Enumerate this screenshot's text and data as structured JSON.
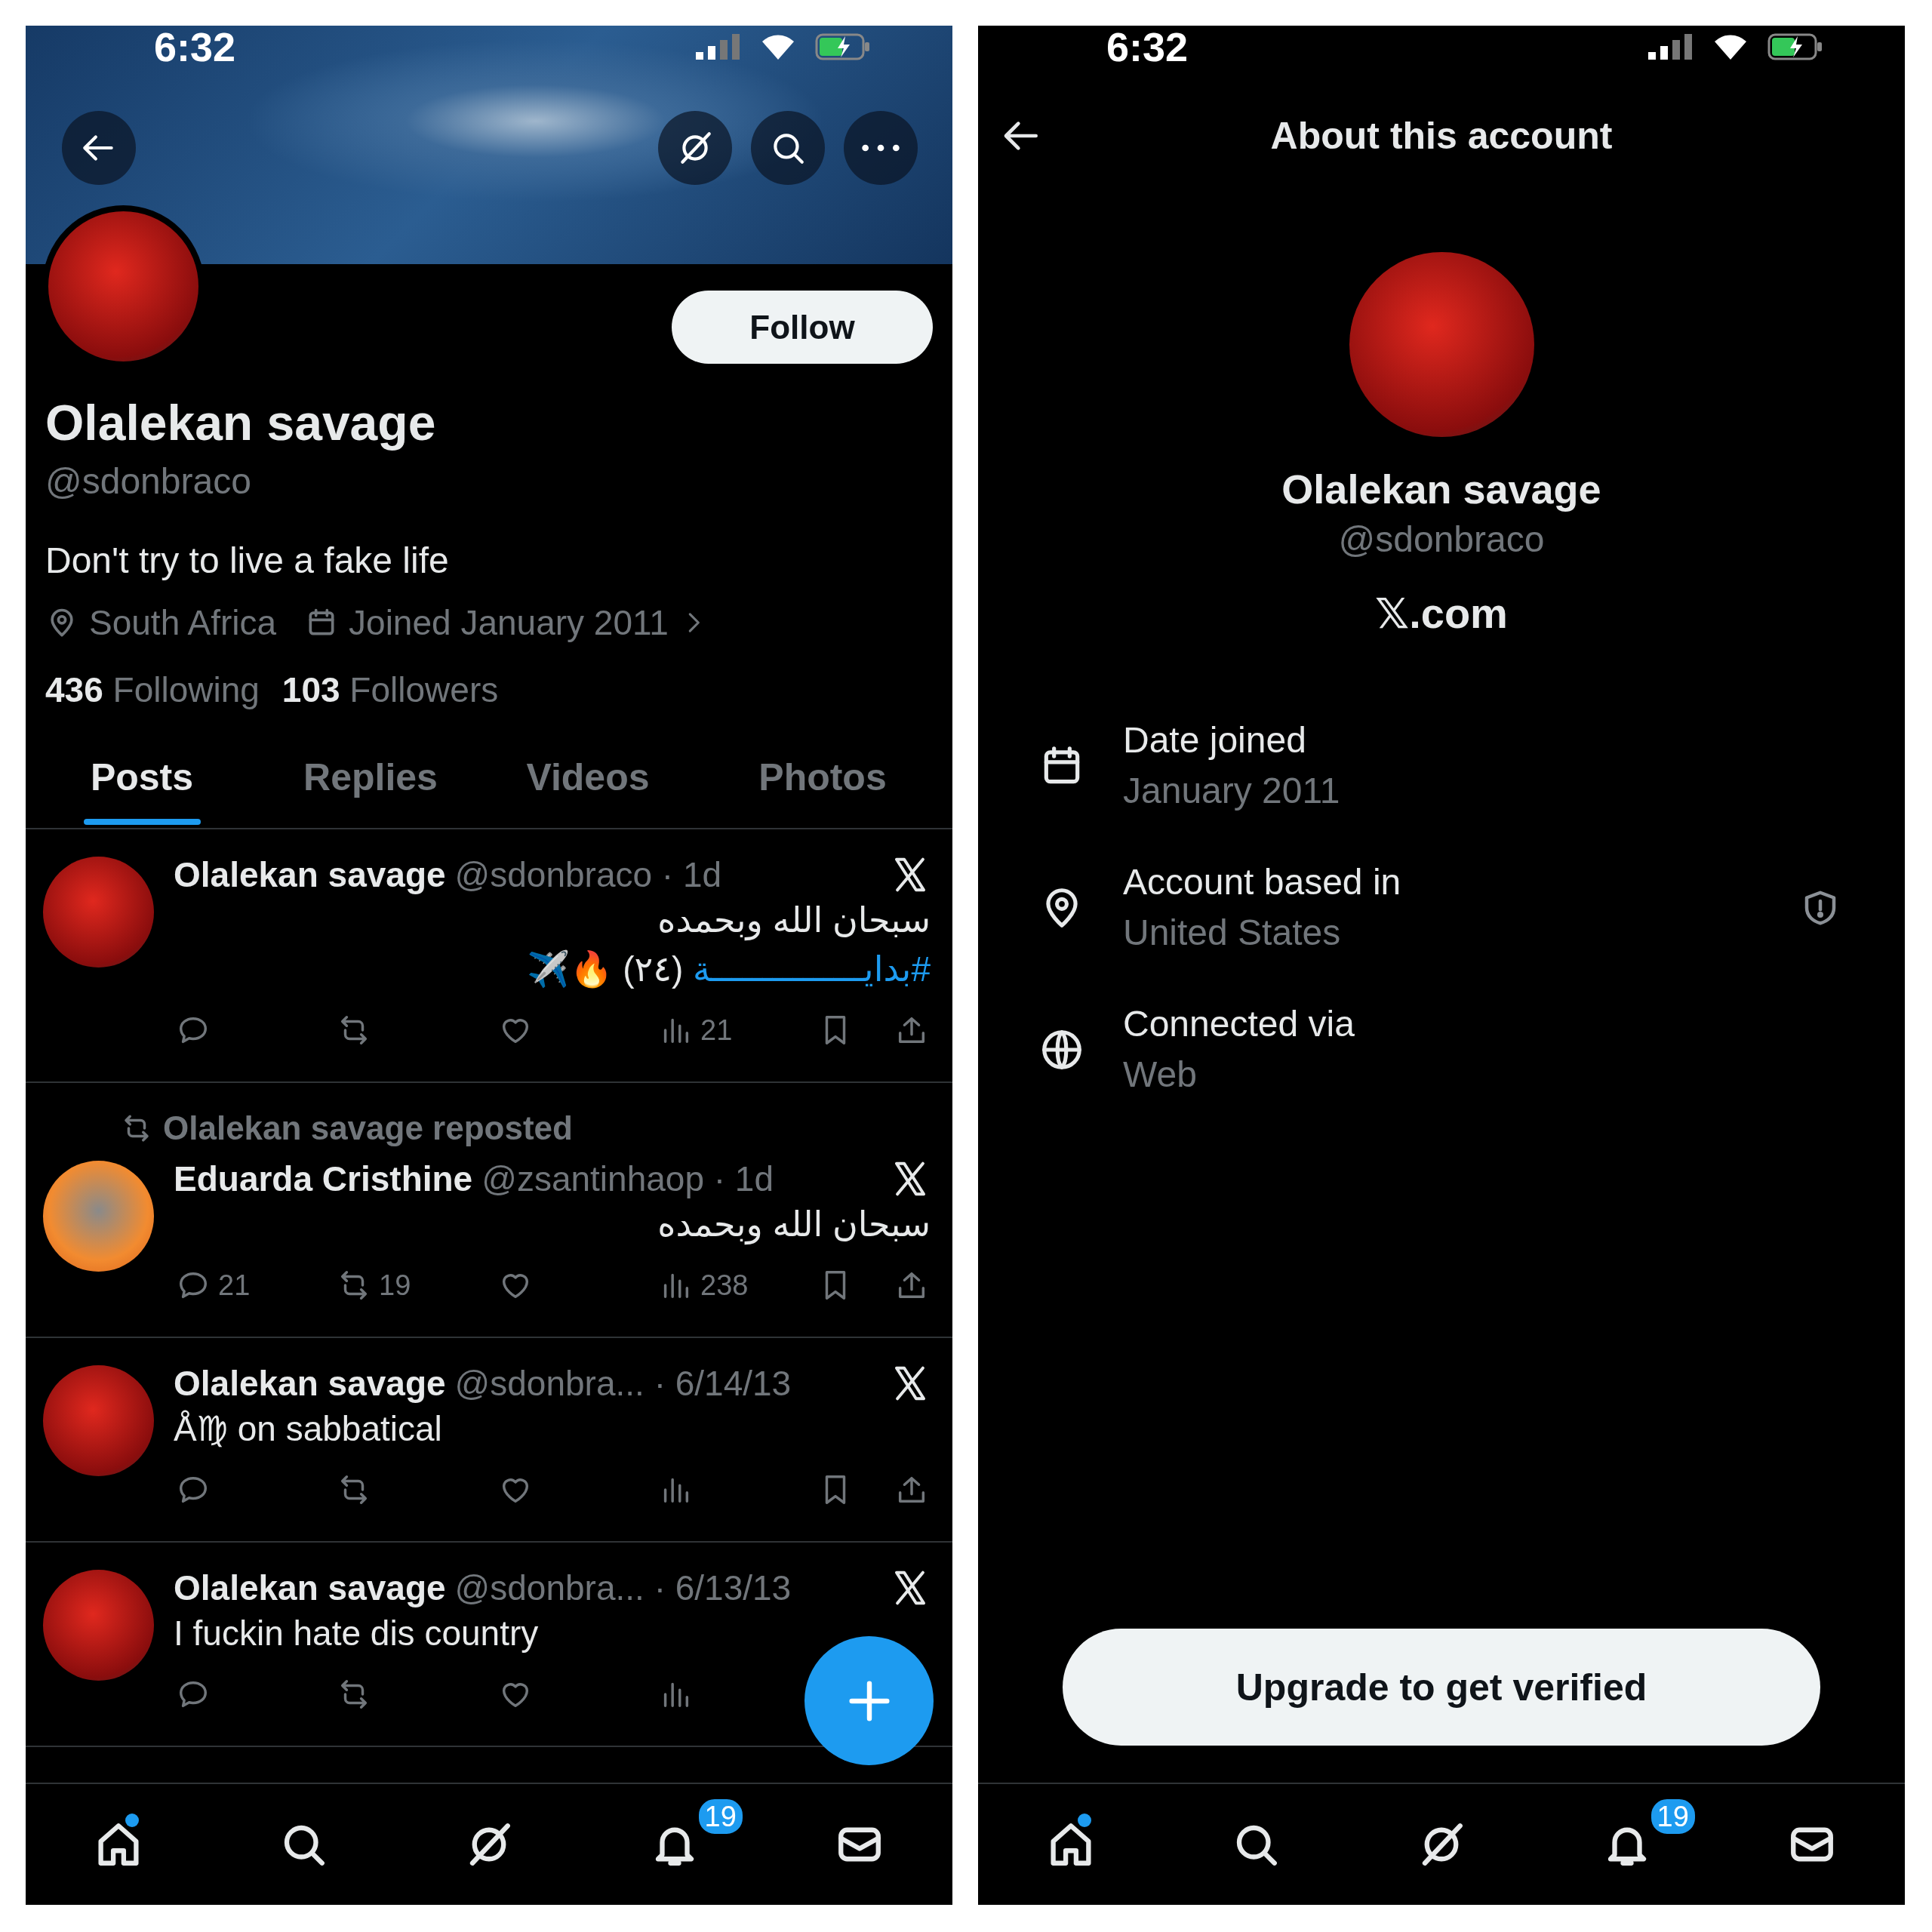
{
  "profile_screen": {
    "status_bar": {
      "time": "6:32"
    },
    "name": "Olalekan savage",
    "handle": "@sdonbraco",
    "follow_button": "Follow",
    "bio": "Don't try to live a fake life",
    "location": "South Africa",
    "joined": "Joined January 2011",
    "following_count": "436",
    "following_label": "Following",
    "followers_count": "103",
    "followers_label": "Followers",
    "tabs": [
      {
        "label": "Posts",
        "selected": true
      },
      {
        "label": "Replies",
        "selected": false
      },
      {
        "label": "Videos",
        "selected": false
      },
      {
        "label": "Photos",
        "selected": false
      }
    ],
    "posts": [
      {
        "kind": "post",
        "name": "Olalekan savage",
        "meta": "@sdonbraco · 1d",
        "rtl": true,
        "lines": [
          {
            "text": "سبحان الله وبحمده"
          },
          {
            "hashtag": "#بدايـــــــــــــــة",
            "text": "(٢٤) 🔥✈️"
          }
        ],
        "actions": [
          {
            "kind": "reply"
          },
          {
            "kind": "repost"
          },
          {
            "kind": "like"
          },
          {
            "kind": "views",
            "count": "21"
          },
          {
            "kind": "bookmark"
          },
          {
            "kind": "share"
          }
        ]
      },
      {
        "kind": "repost",
        "note": "Olalekan savage reposted",
        "name": "Eduarda Cristhine",
        "meta": "@zsantinhaop · 1d",
        "rtl": true,
        "lines": [
          {
            "text": "سبحان الله وبحمده"
          }
        ],
        "actions": [
          {
            "kind": "reply",
            "count": "21"
          },
          {
            "kind": "repost",
            "count": "19"
          },
          {
            "kind": "like"
          },
          {
            "kind": "views",
            "count": "238"
          },
          {
            "kind": "bookmark"
          },
          {
            "kind": "share"
          }
        ]
      },
      {
        "kind": "post",
        "name": "Olalekan savage",
        "meta": "@sdonbra... · 6/14/13",
        "rtl": false,
        "lines": [
          {
            "text": "Å♍ on sabbatical"
          }
        ],
        "actions": [
          {
            "kind": "reply"
          },
          {
            "kind": "repost"
          },
          {
            "kind": "like"
          },
          {
            "kind": "views"
          },
          {
            "kind": "bookmark"
          },
          {
            "kind": "share"
          }
        ]
      },
      {
        "kind": "post",
        "name": "Olalekan savage",
        "meta": "@sdonbra... · 6/13/13",
        "rtl": false,
        "lines": [
          {
            "text": "I fuckin hate dis country"
          }
        ],
        "actions": [
          {
            "kind": "reply"
          },
          {
            "kind": "repost"
          },
          {
            "kind": "like"
          },
          {
            "kind": "views"
          }
        ]
      }
    ],
    "nav": [
      {
        "kind": "home",
        "unread": true
      },
      {
        "kind": "search",
        "unread": false
      },
      {
        "kind": "grok",
        "unread": false
      },
      {
        "kind": "notifications",
        "unread": false,
        "badge": "19"
      },
      {
        "kind": "messages",
        "unread": false
      }
    ]
  },
  "about_screen": {
    "status_bar": {
      "time": "6:32"
    },
    "title": "About this account",
    "name": "Olalekan savage",
    "handle": "@sdonbraco",
    "source": "𝕏.com",
    "rows": [
      {
        "kind": "calendar",
        "label": "Date joined",
        "value": "January 2011",
        "warning": false
      },
      {
        "kind": "location",
        "label": "Account based in",
        "value": "United States",
        "warning": true
      },
      {
        "kind": "globe",
        "label": "Connected via",
        "value": "Web",
        "warning": false
      }
    ],
    "upgrade_button": "Upgrade to get verified",
    "nav": [
      {
        "kind": "home",
        "unread": true
      },
      {
        "kind": "search",
        "unread": false
      },
      {
        "kind": "grok",
        "unread": false
      },
      {
        "kind": "notifications",
        "unread": false,
        "badge": "19"
      },
      {
        "kind": "messages",
        "unread": false
      }
    ]
  }
}
